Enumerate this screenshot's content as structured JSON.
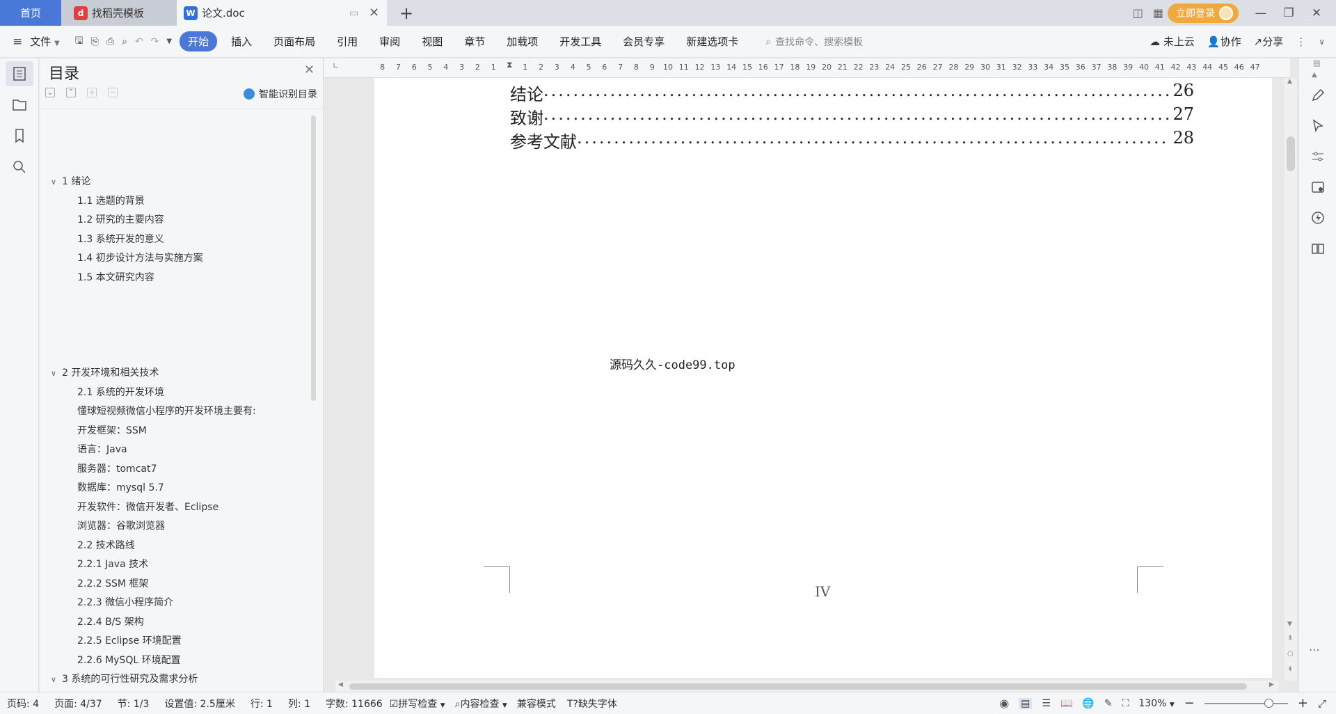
{
  "tabs": {
    "home": "首页",
    "template": "找稻壳模板",
    "doc": "论文.doc",
    "login": "立即登录"
  },
  "menu": {
    "file": "文件",
    "items": [
      "开始",
      "插入",
      "页面布局",
      "引用",
      "审阅",
      "视图",
      "章节",
      "加载项",
      "开发工具",
      "会员专享",
      "新建选项卡"
    ],
    "search_placeholder": "查找命令、搜索模板",
    "cloud": "未上云",
    "collab": "协作",
    "share": "分享"
  },
  "toc_panel": {
    "title": "目录",
    "smart": "智能识别目录",
    "items": [
      {
        "level": 1,
        "text": "1 绪论"
      },
      {
        "level": 2,
        "text": "1.1 选题的背景"
      },
      {
        "level": 2,
        "text": "1.2  研究的主要内容"
      },
      {
        "level": 2,
        "text": "1.3  系统开发的意义"
      },
      {
        "level": 2,
        "text": "1.4 初步设计方法与实施方案"
      },
      {
        "level": 2,
        "text": "1.5  本文研究内容"
      },
      {
        "level": 1,
        "text": "2 开发环境和相关技术"
      },
      {
        "level": 2,
        "text": "2.1 系统的开发环境"
      },
      {
        "level": 2,
        "text": "懂球短视频微信小程序的开发环境主要有:"
      },
      {
        "level": 2,
        "text": "开发框架：SSM"
      },
      {
        "level": 2,
        "text": "语言：Java"
      },
      {
        "level": 2,
        "text": "服务器：tomcat7"
      },
      {
        "level": 2,
        "text": "数据库：mysql 5.7"
      },
      {
        "level": 2,
        "text": "开发软件：微信开发者、Eclipse"
      },
      {
        "level": 2,
        "text": "浏览器：谷歌浏览器"
      },
      {
        "level": 2,
        "text": "2.2 技术路线"
      },
      {
        "level": 2,
        "text": "2.2.1 Java 技术"
      },
      {
        "level": 2,
        "text": "2.2.2 SSM 框架"
      },
      {
        "level": 2,
        "text": "2.2.3 微信小程序简介"
      },
      {
        "level": 2,
        "text": "2.2.4 B/S 架构"
      },
      {
        "level": 2,
        "text": "2.2.5 Eclipse 环境配置"
      },
      {
        "level": 2,
        "text": "2.2.6 MySQL 环境配置"
      },
      {
        "level": 1,
        "text": "3 系统的可行性研究及需求分析"
      }
    ]
  },
  "ruler": {
    "left_ticks": [
      "8",
      "7",
      "6",
      "5",
      "4",
      "3",
      "2",
      "1"
    ],
    "right_ticks": [
      "1",
      "2",
      "3",
      "4",
      "5",
      "6",
      "7",
      "8",
      "9",
      "10",
      "11",
      "12",
      "13",
      "14",
      "15",
      "16",
      "17",
      "18",
      "19",
      "20",
      "21",
      "22",
      "23",
      "24",
      "25",
      "26",
      "27",
      "28",
      "29",
      "30",
      "31",
      "32",
      "33",
      "34",
      "35",
      "36",
      "37",
      "38",
      "39",
      "40",
      "41",
      "42",
      "43",
      "44",
      "45",
      "46",
      "47"
    ]
  },
  "document": {
    "toc_lines": [
      {
        "title": "结论",
        "page": "26"
      },
      {
        "title": "致谢",
        "page": "27"
      },
      {
        "title": "参考文献",
        "page": "28"
      }
    ],
    "watermark": "源码久久-code99.top",
    "page_number": "IV"
  },
  "status": {
    "page_code": "页码: 4",
    "page": "页面: 4/37",
    "section": "节: 1/3",
    "setting": "设置值: 2.5厘米",
    "row": "行: 1",
    "col": "列: 1",
    "words": "字数: 11666",
    "spell": "拼写检查",
    "content_check": "内容检查",
    "compat": "兼容模式",
    "missing_font": "缺失字体",
    "zoom": "130%"
  }
}
